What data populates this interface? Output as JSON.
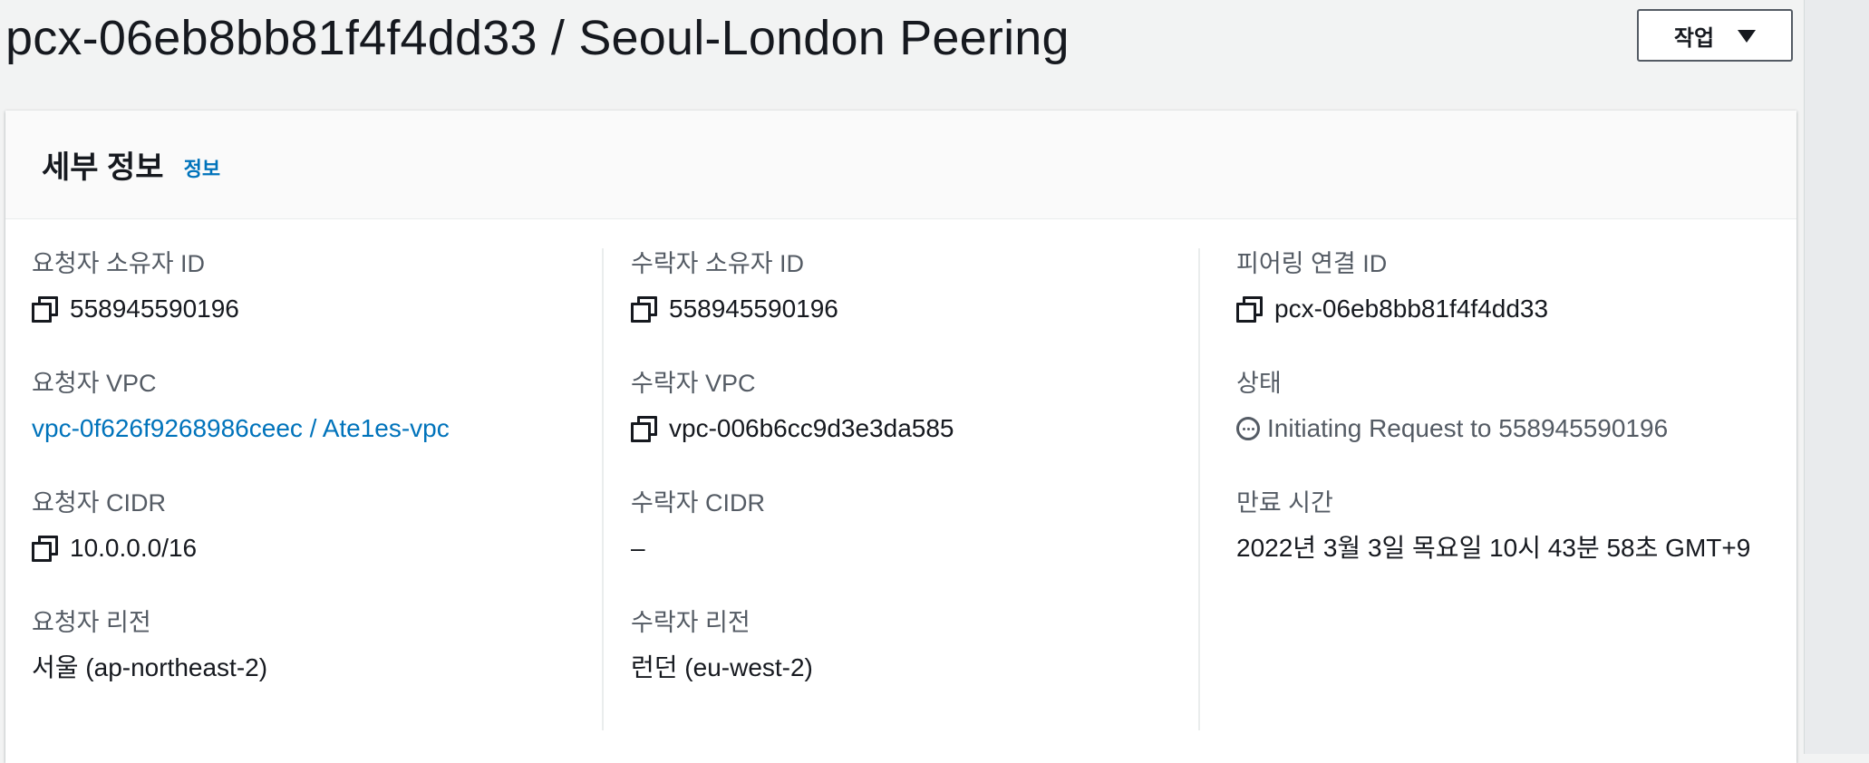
{
  "header": {
    "title": "pcx-06eb8bb81f4f4dd33 / Seoul-London Peering",
    "actions_label": "작업"
  },
  "details": {
    "title": "세부 정보",
    "info_link": "정보",
    "columns": [
      {
        "fields": [
          {
            "label": "요청자 소유자 ID",
            "value": "558945590196",
            "copyable": true
          },
          {
            "label": "요청자 VPC",
            "value": "vpc-0f626f9268986ceec / Ate1es-vpc",
            "link": true
          },
          {
            "label": "요청자 CIDR",
            "value": "10.0.0.0/16",
            "copyable": true
          },
          {
            "label": "요청자 리전",
            "value": "서울 (ap-northeast-2)"
          }
        ]
      },
      {
        "fields": [
          {
            "label": "수락자 소유자 ID",
            "value": "558945590196",
            "copyable": true
          },
          {
            "label": "수락자 VPC",
            "value": "vpc-006b6cc9d3e3da585",
            "copyable": true
          },
          {
            "label": "수락자 CIDR",
            "value": "–"
          },
          {
            "label": "수락자 리전",
            "value": "런던 (eu-west-2)"
          }
        ]
      },
      {
        "fields": [
          {
            "label": "피어링 연결 ID",
            "value": "pcx-06eb8bb81f4f4dd33",
            "copyable": true
          },
          {
            "label": "상태",
            "value": "Initiating Request to 558945590196",
            "status_icon": "pending-icon",
            "status_color": "#545b64"
          },
          {
            "label": "만료 시간",
            "value": "2022년 3월 3일 목요일 10시 43분 58초 GMT+9"
          }
        ]
      }
    ]
  },
  "colors": {
    "link": "#0073bb",
    "text": "#16191f",
    "label": "#545b64",
    "background": "#f2f3f3"
  }
}
